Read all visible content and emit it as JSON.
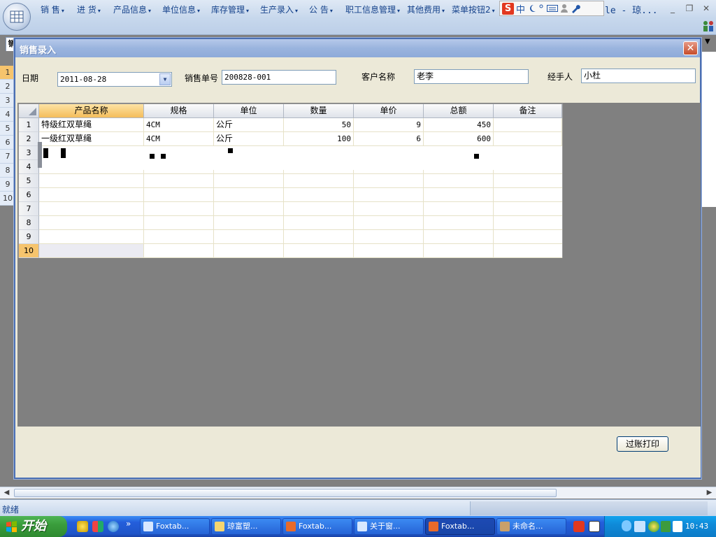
{
  "menubar": {
    "items": [
      {
        "label": "销 售"
      },
      {
        "label": "进 货"
      },
      {
        "label": "产品信息"
      },
      {
        "label": "单位信息"
      },
      {
        "label": "库存管理"
      },
      {
        "label": "生产录入"
      },
      {
        "label": "公 告"
      },
      {
        "label": "职工信息管理"
      },
      {
        "label": "其他费用"
      },
      {
        "label": "菜单按钮2"
      }
    ],
    "ime": {
      "mode": "中"
    },
    "title_tail": "le - 琼...",
    "minimize": "_",
    "restore": "❐",
    "close": "✕"
  },
  "background_sheet": {
    "tab_label": "销",
    "row_numbers": [
      "1",
      "2",
      "3",
      "4",
      "5",
      "6",
      "7",
      "8",
      "9",
      "10"
    ]
  },
  "dialog": {
    "title": "销售录入",
    "close_glyph": "✕",
    "form": {
      "date_label": "日期",
      "date_value": "2011-08-28",
      "order_label": "销售单号",
      "order_value": "200828-001",
      "customer_label": "客户名称",
      "customer_value": "老李",
      "handler_label": "经手人",
      "handler_value": "小杜"
    },
    "grid": {
      "columns": [
        "产品名称",
        "规格",
        "单位",
        "数量",
        "单价",
        "总额",
        "备注"
      ],
      "row_numbers": [
        "1",
        "2",
        "3",
        "4",
        "5",
        "6",
        "7",
        "8",
        "9",
        "10"
      ],
      "rows": [
        {
          "name": "特级红双草绳",
          "spec": "4CM",
          "unit": "公斤",
          "qty": "50",
          "price": "9",
          "total": "450",
          "note": ""
        },
        {
          "name": "一级红双草绳",
          "spec": "4CM",
          "unit": "公斤",
          "qty": "100",
          "price": "6",
          "total": "600",
          "note": ""
        }
      ],
      "selected_row": "10"
    },
    "post_print_button": "过账打印"
  },
  "statusbar": {
    "text": "就绪"
  },
  "taskbar": {
    "start_label": "开始",
    "tasks": [
      {
        "label": "Foxtab..."
      },
      {
        "label": "琼富塑..."
      },
      {
        "label": "Foxtab..."
      },
      {
        "label": "关于窗..."
      },
      {
        "label": "Foxtab..."
      },
      {
        "label": "未命名..."
      }
    ],
    "clock": "10:43"
  },
  "colors": {
    "dialog_bg": "#ece9d8",
    "title_bar": "#9ab4de",
    "selected_header": "#f4bd5b",
    "taskbar_blue": "#245edb",
    "start_green": "#3a9d3c"
  }
}
